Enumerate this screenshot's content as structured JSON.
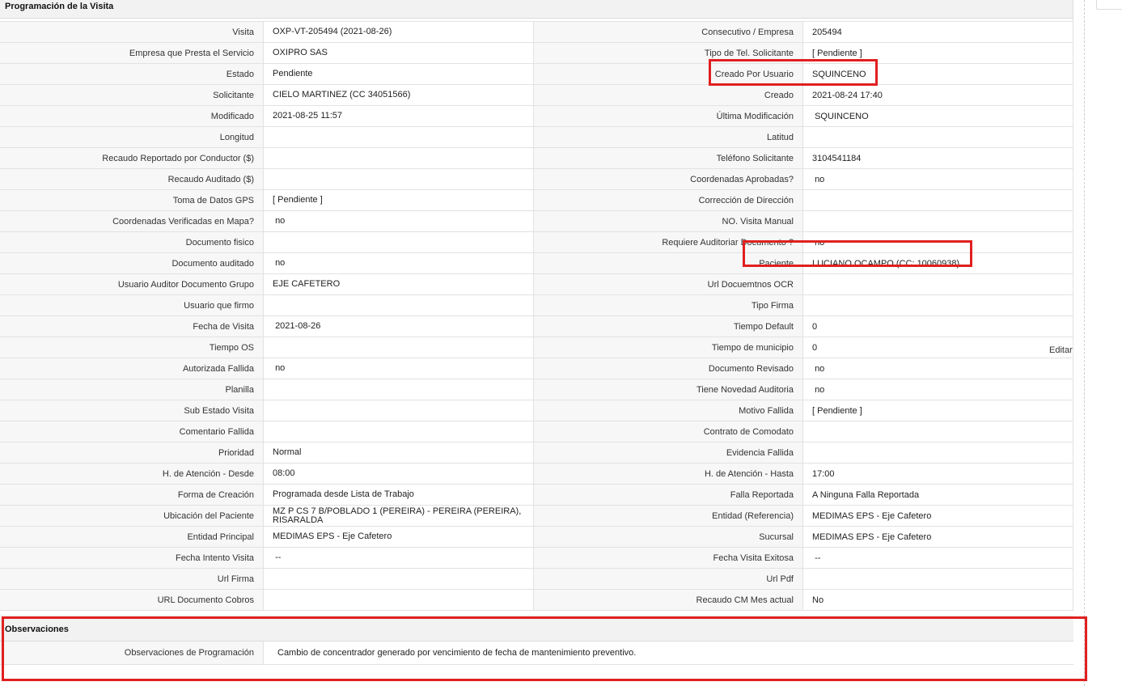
{
  "section_title": "Programación de la Visita",
  "rows": [
    {
      "l1": "Visita",
      "v1": "OXP-VT-205494 (2021-08-26)",
      "l2": "Consecutivo / Empresa",
      "v2": "205494"
    },
    {
      "l1": "Empresa que Presta el Servicio",
      "v1": "OXIPRO SAS",
      "l2": "Tipo de Tel. Solicitante",
      "v2": "[ Pendiente ]"
    },
    {
      "l1": "Estado",
      "v1": "Pendiente",
      "l2": "Creado Por Usuario",
      "v2": "SQUINCENO"
    },
    {
      "l1": "Solicitante",
      "v1": "CIELO MARTINEZ (CC 34051566)",
      "l2": "Creado",
      "v2": "2021-08-24 17:40"
    },
    {
      "l1": "Modificado",
      "v1": "2021-08-25 11:57",
      "l2": "Última Modificación",
      "v2": " SQUINCENO"
    },
    {
      "l1": "Longitud",
      "v1": "",
      "l2": "Latitud",
      "v2": ""
    },
    {
      "l1": "Recaudo Reportado por Conductor ($)",
      "v1": "",
      "l2": "Teléfono Solicitante",
      "v2": "3104541184"
    },
    {
      "l1": "Recaudo Auditado ($)",
      "v1": "",
      "l2": "Coordenadas Aprobadas?",
      "v2": " no"
    },
    {
      "l1": "Toma de Datos GPS",
      "v1": "[ Pendiente ]",
      "l2": "Corrección de Dirección",
      "v2": ""
    },
    {
      "l1": "Coordenadas Verificadas en Mapa?",
      "v1": " no",
      "l2": "NO. Visita Manual",
      "v2": ""
    },
    {
      "l1": "Documento fisico",
      "v1": "",
      "l2": "Requiere Auditoriar Documento ?",
      "v2": " no"
    },
    {
      "l1": "Documento auditado",
      "v1": " no",
      "l2": "Paciente",
      "v2": "LUCIANO OCAMPO (CC: 10060938)"
    },
    {
      "l1": "Usuario Auditor Documento Grupo",
      "v1": "EJE CAFETERO",
      "l2": "Url Docuemtnos OCR",
      "v2": ""
    },
    {
      "l1": "Usuario que firmo",
      "v1": "",
      "l2": "Tipo Firma",
      "v2": ""
    },
    {
      "l1": "Fecha de Visita",
      "v1": " 2021-08-26",
      "l2": "Tiempo Default",
      "v2": "0"
    },
    {
      "l1": "Tiempo OS",
      "v1": "",
      "l2": "Tiempo de municipio",
      "v2": "0"
    },
    {
      "l1": "Autorizada Fallida",
      "v1": " no",
      "l2": "Documento Revisado",
      "v2": " no"
    },
    {
      "l1": "Planilla",
      "v1": "",
      "l2": "Tiene Novedad Auditoria",
      "v2": " no"
    },
    {
      "l1": "Sub Estado Visita",
      "v1": "",
      "l2": "Motivo Fallida",
      "v2": "[ Pendiente ]"
    },
    {
      "l1": "Comentario Fallida",
      "v1": "",
      "l2": "Contrato de Comodato",
      "v2": ""
    },
    {
      "l1": "Prioridad",
      "v1": "Normal",
      "l2": "Evidencia Fallida",
      "v2": ""
    },
    {
      "l1": "H. de Atención - Desde",
      "v1": "08:00",
      "l2": "H. de Atención - Hasta",
      "v2": "17:00"
    },
    {
      "l1": "Forma de Creación",
      "v1": "Programada desde Lista de Trabajo",
      "l2": "Falla Reportada",
      "v2": "A Ninguna Falla Reportada"
    },
    {
      "l1": "Ubicación del Paciente",
      "v1": "MZ P CS 7 B/POBLADO 1 (PEREIRA) - PEREIRA (PEREIRA), RISARALDA",
      "l2": "Entidad (Referencia)",
      "v2": "MEDIMAS EPS - Eje Cafetero"
    },
    {
      "l1": "Entidad Principal",
      "v1": "MEDIMAS EPS - Eje Cafetero",
      "l2": "Sucursal",
      "v2": "MEDIMAS EPS - Eje Cafetero"
    },
    {
      "l1": "Fecha Intento Visita",
      "v1": " --",
      "l2": "Fecha Visita Exitosa",
      "v2": " --"
    },
    {
      "l1": "Url Firma",
      "v1": "",
      "l2": "Url Pdf",
      "v2": ""
    },
    {
      "l1": "URL Documento Cobros",
      "v1": "",
      "l2": "Recaudo CM Mes actual",
      "v2": "No"
    }
  ],
  "edit_link": "Editar",
  "observaciones": {
    "title": "Observaciones",
    "label": "Observaciones de Programación",
    "value": "Cambio de concentrador generado por vencimiento de fecha de mantenimiento preventivo."
  },
  "highlight_color": "#e02020"
}
